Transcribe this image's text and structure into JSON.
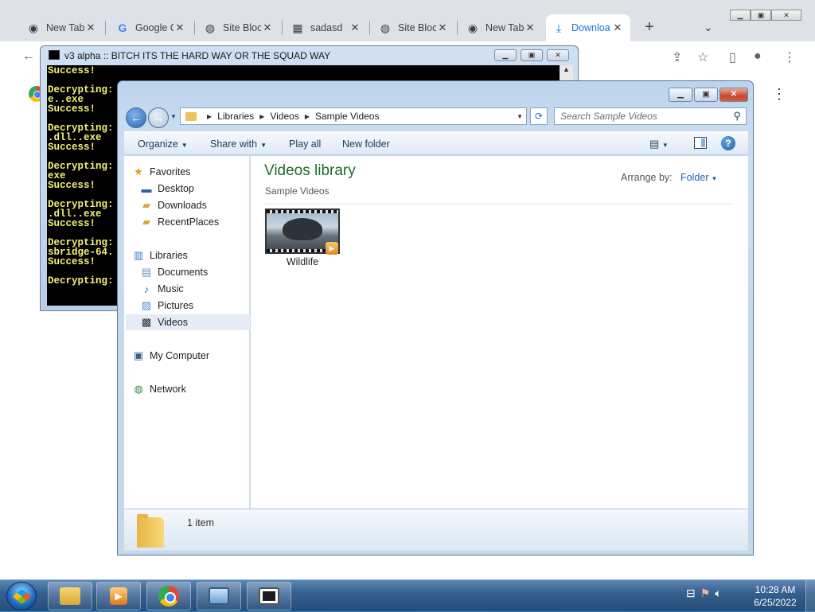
{
  "browser": {
    "tabs": [
      {
        "title": "New Tab",
        "icon": "chrome-icon"
      },
      {
        "title": "Google C",
        "icon": "google-icon"
      },
      {
        "title": "Site Bloc",
        "icon": "globe-icon"
      },
      {
        "title": "sadasd",
        "icon": "qr-icon"
      },
      {
        "title": "Site Bloc",
        "icon": "globe-icon"
      },
      {
        "title": "New Tab",
        "icon": "chrome-icon"
      },
      {
        "title": "Downloa",
        "icon": "download-icon",
        "active": true
      }
    ],
    "new_tab": "+",
    "menu": "⋮"
  },
  "console": {
    "title": "v3 alpha :: BITCH ITS THE HARD WAY OR THE SQUAD WAY",
    "lines": [
      "Success!",
      "",
      "Decrypting:",
      "e..exe",
      "Success!",
      "",
      "Decrypting:",
      ".dll..exe",
      "Success!",
      "",
      "Decrypting:",
      "exe",
      "Success!",
      "",
      "Decrypting:",
      ".dll..exe",
      "Success!",
      "",
      "Decrypting:",
      "sbridge-64.",
      "Success!",
      "",
      "Decrypting:"
    ]
  },
  "explorer": {
    "breadcrumb": [
      "Libraries",
      "Videos",
      "Sample Videos"
    ],
    "search_placeholder": "Search Sample Videos",
    "commands": {
      "organize": "Organize",
      "share_with": "Share with",
      "play_all": "Play all",
      "new_folder": "New folder"
    },
    "nav": {
      "favorites": "Favorites",
      "desktop": "Desktop",
      "downloads": "Downloads",
      "recent_places": "RecentPlaces",
      "libraries": "Libraries",
      "documents": "Documents",
      "music": "Music",
      "pictures": "Pictures",
      "videos": "Videos",
      "my_computer": "My Computer",
      "network": "Network"
    },
    "library_title": "Videos library",
    "library_subtitle": "Sample Videos",
    "arrange_by_label": "Arrange by:",
    "arrange_by_value": "Folder",
    "items": [
      {
        "name": "Wildlife"
      }
    ],
    "item_count": "1 item"
  },
  "taskbar": {
    "time": "10:28 AM",
    "date": "6/25/2022"
  },
  "colors": {
    "library_title": "#1e6b2a",
    "console_text": "#f2f277",
    "active_tab_text": "#1a73e8"
  }
}
